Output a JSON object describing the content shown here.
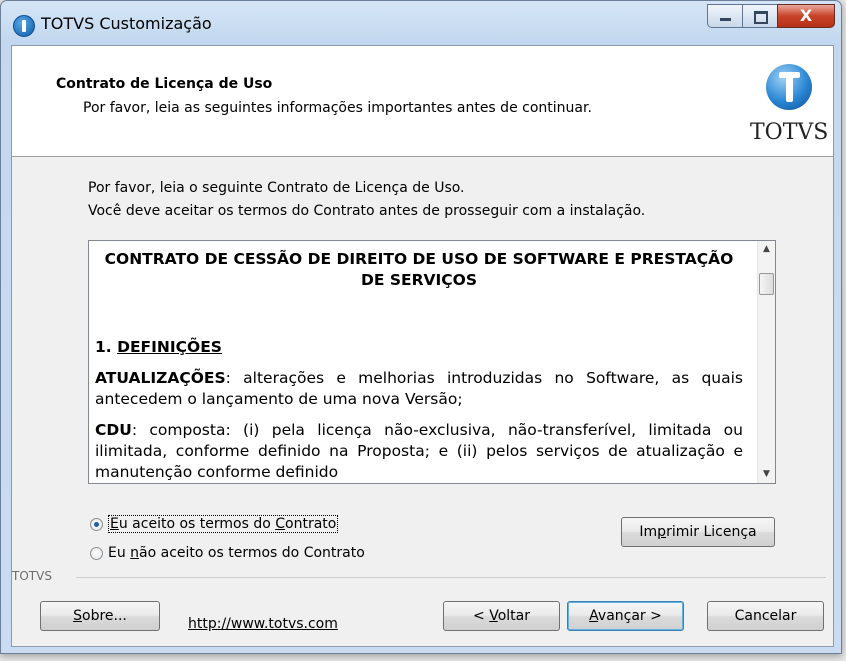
{
  "window": {
    "title": "TOTVS Customização",
    "close_glyph": "X"
  },
  "header": {
    "title": "Contrato de Licença de Uso",
    "subtitle": "Por favor, leia as seguintes informações importantes antes de continuar.",
    "logo_text": "TOTVS"
  },
  "intro": {
    "line1": "Por favor, leia o seguinte Contrato de Licença de Uso.",
    "line2": "Você deve aceitar os termos do Contrato antes de prosseguir com a instalação."
  },
  "license": {
    "title": "CONTRATO DE CESSÃO DE DIREITO DE USO DE SOFTWARE E PRESTAÇÃO DE SERVIÇOS",
    "section_number": "1.",
    "section_title": "DEFINIÇÕES",
    "p1_term": "ATUALIZAÇÕES",
    "p1_text": ": alterações e melhorias introduzidas no Software, as quais antecedem o lançamento de uma nova Versão;",
    "p2_term": "CDU",
    "p2_text": ": composta: (i) pela licença não-exclusiva, não-transferível, limitada ou ilimitada, conforme definido na Proposta; e (ii) pelos serviços de atualização e manutenção conforme definido"
  },
  "options": {
    "accept_pre": "",
    "accept_key": "E",
    "accept_mid": "u aceito os termos do ",
    "accept_key2": "C",
    "accept_post": "ontrato",
    "accept_selected": true,
    "reject_pre": "Eu ",
    "reject_key": "n",
    "reject_post": "ão aceito os termos do Contrato",
    "reject_selected": false
  },
  "buttons": {
    "print_pre": "Im",
    "print_key": "p",
    "print_post": "rimir Licença",
    "about_key": "S",
    "about_post": "obre...",
    "back_pre": "< ",
    "back_key": "V",
    "back_post": "oltar",
    "next_key": "A",
    "next_post": "vançar >",
    "cancel": "Cancelar"
  },
  "footer": {
    "group_label": "TOTVS",
    "link": "http://www.totvs.com"
  },
  "colors": {
    "accent": "#3c7fb1",
    "background": "#f0f0f0"
  }
}
